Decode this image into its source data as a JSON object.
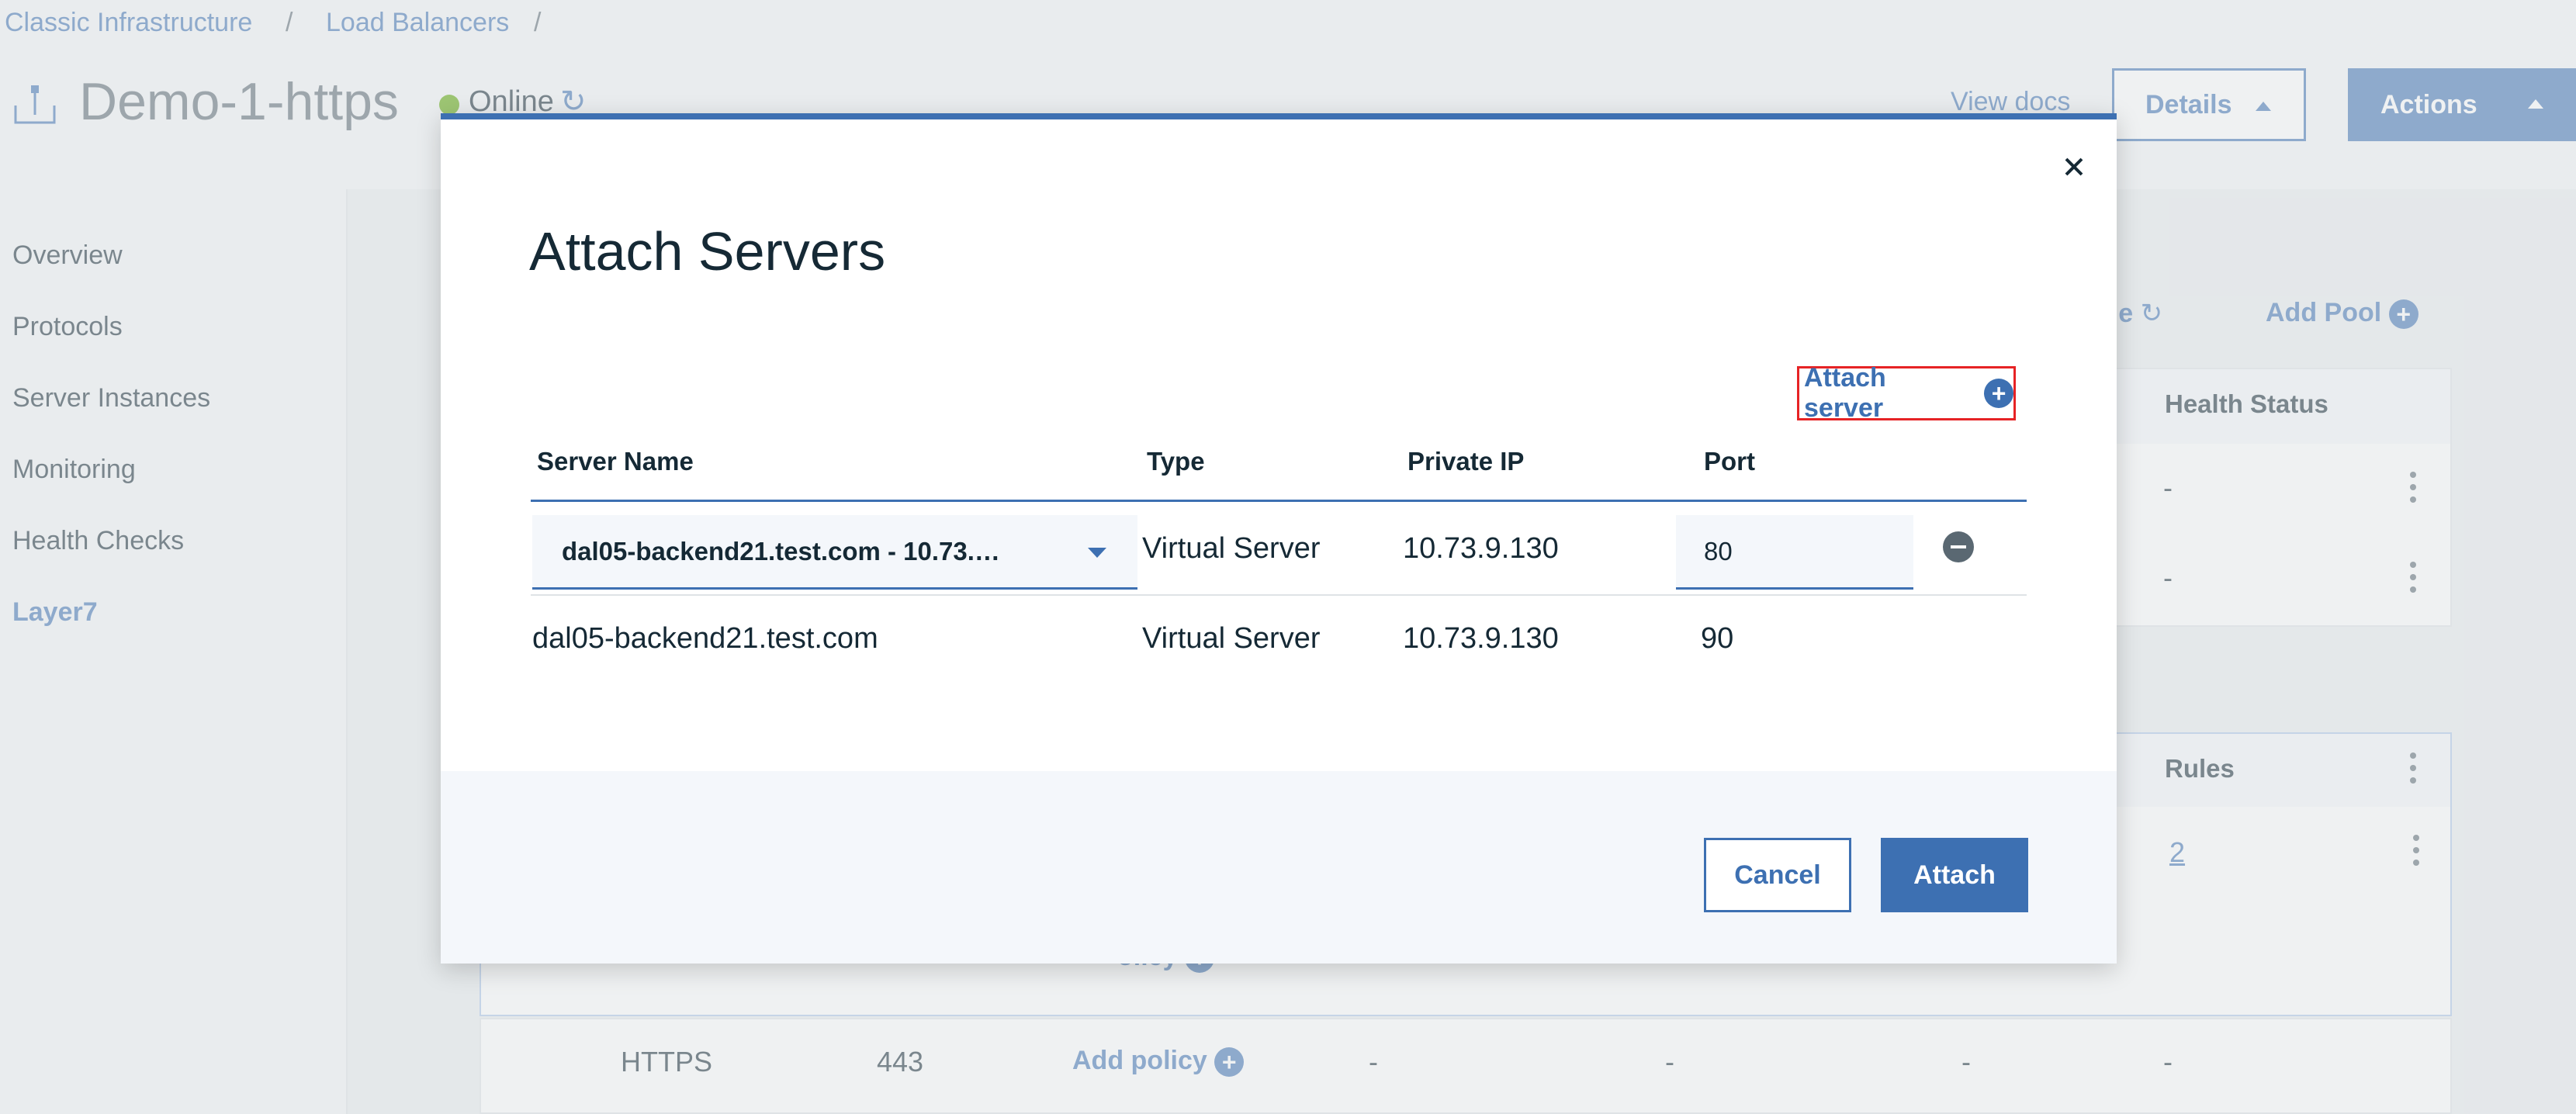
{
  "breadcrumb": {
    "items": [
      "Classic Infrastructure",
      "Load Balancers"
    ],
    "separator": "/"
  },
  "header": {
    "title": "Demo-1-https",
    "status": "Online",
    "view_docs": "View docs",
    "details_label": "Details",
    "actions_label": "Actions"
  },
  "sidebar": {
    "items": [
      {
        "label": "Overview"
      },
      {
        "label": "Protocols"
      },
      {
        "label": "Server Instances"
      },
      {
        "label": "Monitoring"
      },
      {
        "label": "Health Checks"
      },
      {
        "label": "Layer7",
        "active": true
      }
    ]
  },
  "background": {
    "refresh_table_partial": "ble",
    "add_pool": "Add Pool",
    "pool_table_header": "Health Status",
    "pool_rows": [
      {
        "health": "-"
      },
      {
        "health": "-"
      }
    ],
    "policy_table_header": "Rules",
    "policy_row_rules": "2",
    "add_policy_partial": "olicy",
    "https_row": {
      "protocol": "HTTPS",
      "port": "443",
      "add_policy": "Add policy",
      "c1": "-",
      "c2": "-",
      "c3": "-",
      "c4": "-"
    }
  },
  "modal": {
    "title": "Attach Servers",
    "attach_server_link": "Attach server",
    "columns": [
      "Server Name",
      "Type",
      "Private IP",
      "Port"
    ],
    "editable_row": {
      "server_select": "dal05-backend21.test.com - 10.73.…",
      "type": "Virtual Server",
      "private_ip": "10.73.9.130",
      "port": "80"
    },
    "rows": [
      {
        "server_name": "dal05-backend21.test.com",
        "type": "Virtual Server",
        "private_ip": "10.73.9.130",
        "port": "90"
      }
    ],
    "cancel_label": "Cancel",
    "attach_label": "Attach"
  },
  "colors": {
    "accent": "#3d70b2",
    "online": "#5aa700",
    "highlight": "#e62325"
  }
}
